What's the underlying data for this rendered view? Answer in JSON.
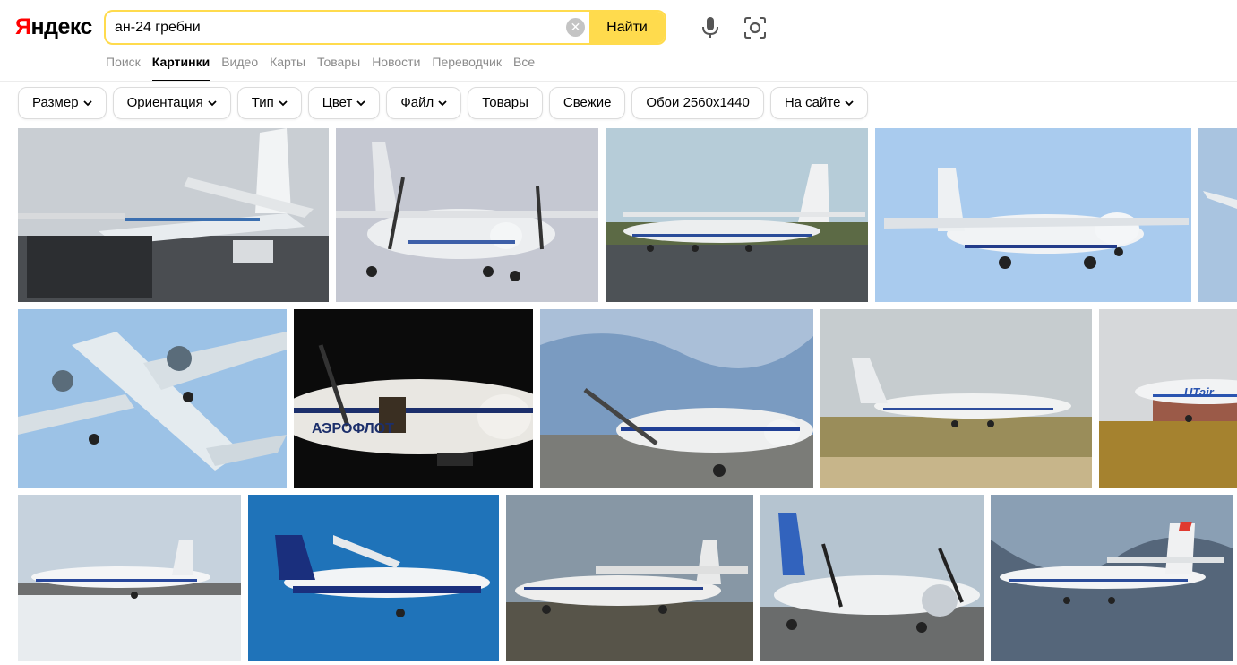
{
  "logo": {
    "first": "Я",
    "rest": "ндекс"
  },
  "search": {
    "value": "ан-24 гребни",
    "button": "Найти"
  },
  "services": [
    {
      "label": "Поиск",
      "active": false
    },
    {
      "label": "Картинки",
      "active": true
    },
    {
      "label": "Видео",
      "active": false
    },
    {
      "label": "Карты",
      "active": false
    },
    {
      "label": "Товары",
      "active": false
    },
    {
      "label": "Новости",
      "active": false
    },
    {
      "label": "Переводчик",
      "active": false
    },
    {
      "label": "Все",
      "active": false
    }
  ],
  "filters": [
    {
      "label": "Размер",
      "dropdown": true
    },
    {
      "label": "Ориентация",
      "dropdown": true
    },
    {
      "label": "Тип",
      "dropdown": true
    },
    {
      "label": "Цвет",
      "dropdown": true
    },
    {
      "label": "Файл",
      "dropdown": true
    },
    {
      "label": "Товары",
      "dropdown": false
    },
    {
      "label": "Свежие",
      "dropdown": false
    },
    {
      "label": "Обои 2560x1440",
      "dropdown": false
    },
    {
      "label": "На сайте",
      "dropdown": true
    }
  ],
  "icons": {
    "clear": "close-icon",
    "mic": "microphone-icon",
    "lens": "camera-lens-icon",
    "chevron": "chevron-down-icon"
  },
  "colors": {
    "accent": "#ffdb4d",
    "logo_red": "#ff0000"
  },
  "thumb_text": {
    "t6": "АЭРОФЛОТ",
    "t7": "АЭРОФЛОТ",
    "t10": "UTair"
  }
}
